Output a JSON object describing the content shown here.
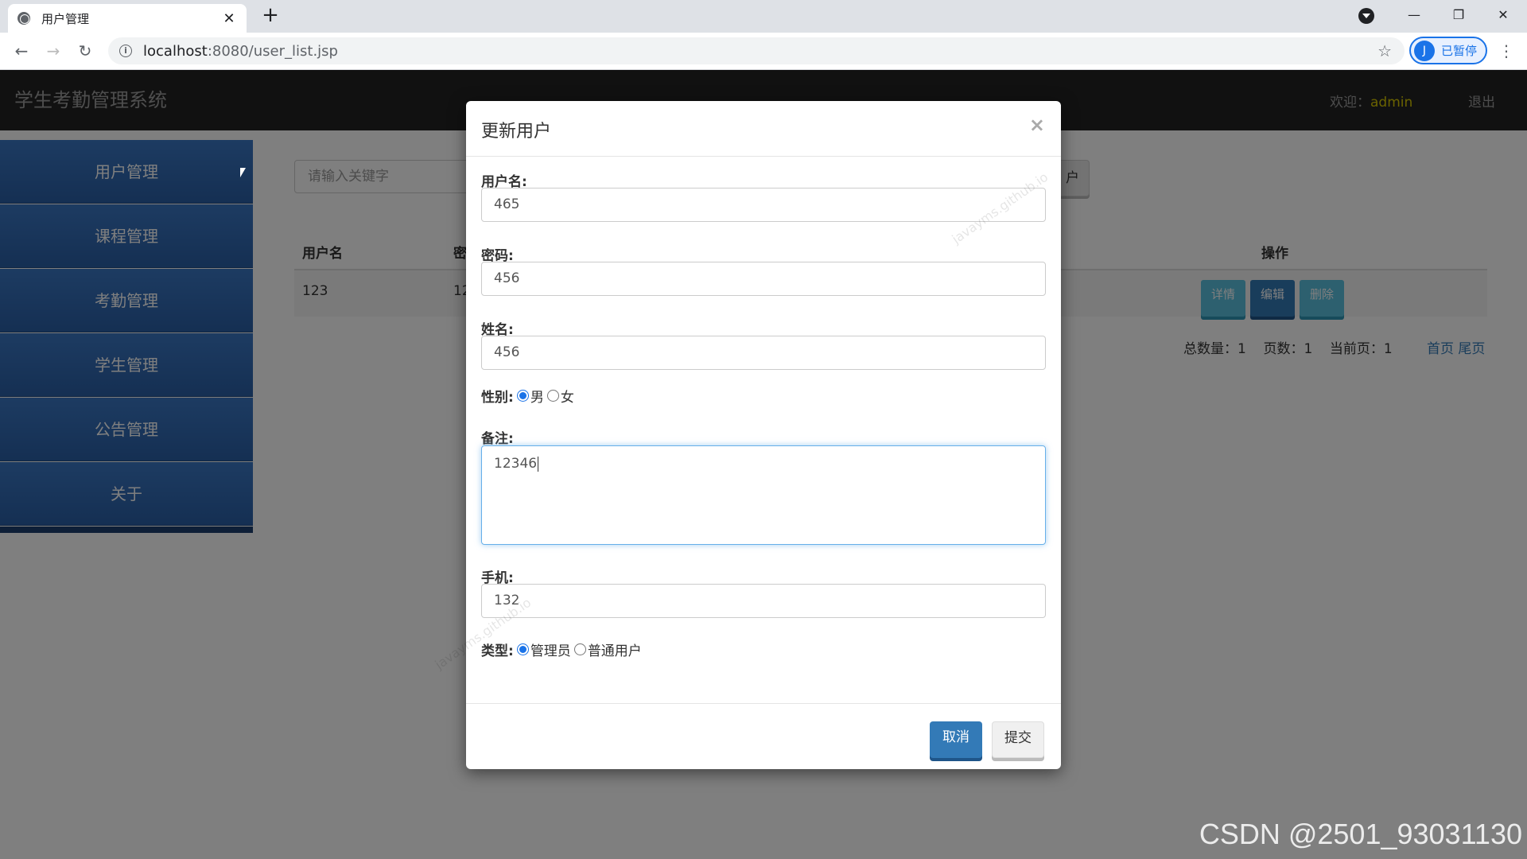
{
  "browser": {
    "tab_title": "用户管理",
    "url_host": "localhost",
    "url_rest": ":8080/user_list.jsp",
    "profile_initial": "J",
    "profile_status": "已暂停"
  },
  "app": {
    "brand": "学生考勤管理系统",
    "welcome_label": "欢迎：",
    "welcome_user": "admin",
    "logout": "退出"
  },
  "sidebar": {
    "items": [
      {
        "label": "用户管理"
      },
      {
        "label": "课程管理"
      },
      {
        "label": "考勤管理"
      },
      {
        "label": "学生管理"
      },
      {
        "label": "公告管理"
      },
      {
        "label": "关于"
      }
    ]
  },
  "main": {
    "search_placeholder": "请输入关键字",
    "add_button_label": "户",
    "table": {
      "headers": {
        "username": "用户名",
        "password": "密",
        "actions": "操作"
      },
      "rows": [
        {
          "username": "123",
          "password": "12"
        }
      ],
      "actions": {
        "detail": "详情",
        "edit": "编辑",
        "delete": "删除"
      }
    },
    "pager": {
      "total_label": "总数量：",
      "total": "1",
      "pages_label": "页数：",
      "pages": "1",
      "current_label": "当前页：",
      "current": "1",
      "first": "首页",
      "last": "尾页"
    }
  },
  "modal": {
    "title": "更新用户",
    "close": "×",
    "username_label": "用户名:",
    "username_value": "465",
    "password_label": "密码:",
    "password_value": "456",
    "name_label": "姓名:",
    "name_value": "456",
    "gender_label": "性别:",
    "gender_options": [
      "男",
      "女"
    ],
    "gender_selected": "男",
    "remark_label": "备注:",
    "remark_value": "12346",
    "phone_label": "手机:",
    "phone_value": "132",
    "type_label": "类型:",
    "type_options": [
      "管理员",
      "普通用户"
    ],
    "type_selected": "管理员",
    "cancel_label": "取消",
    "submit_label": "提交"
  },
  "watermarks": {
    "site": "javayms.github.io",
    "csdn": "CSDN @2501_93031130"
  },
  "colors": {
    "primary": "#337ab7",
    "info": "#5bc0de",
    "navbar": "#222222",
    "sidebar": "#2a5fa6",
    "welcome_user": "#d4c400"
  }
}
